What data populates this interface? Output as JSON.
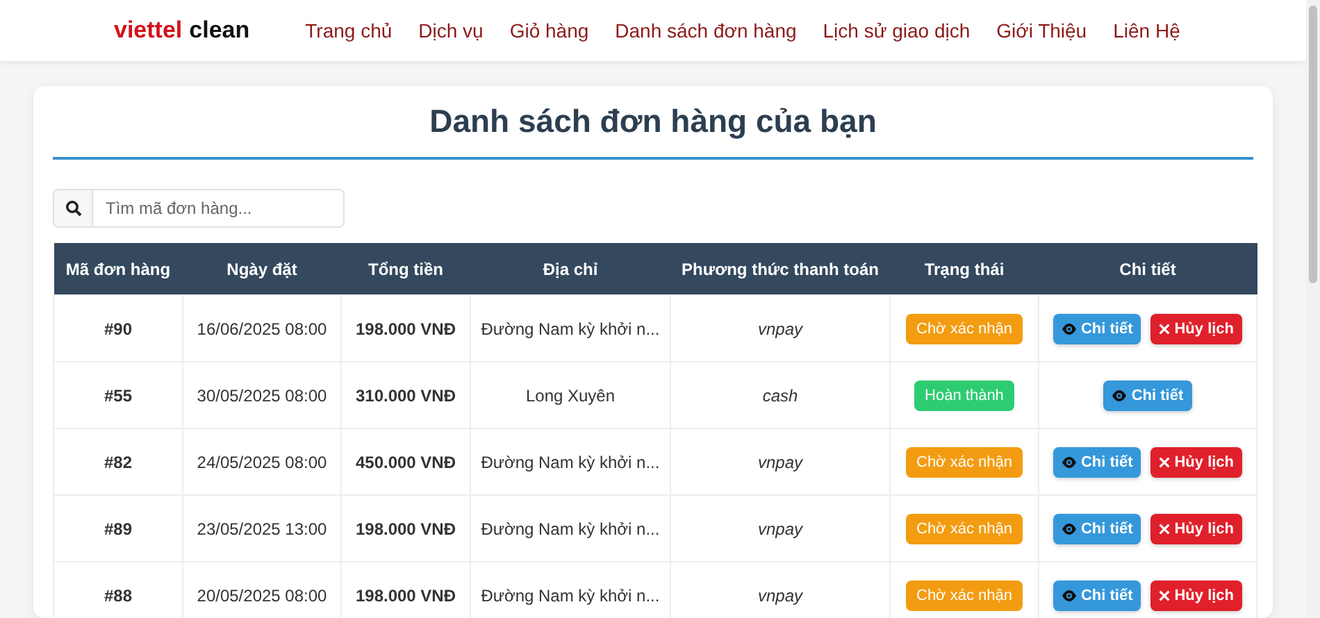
{
  "brand": {
    "first": "viettel",
    "second": "clean"
  },
  "nav": [
    {
      "label": "Trang chủ"
    },
    {
      "label": "Dịch vụ"
    },
    {
      "label": "Giỏ hàng"
    },
    {
      "label": "Danh sách đơn hàng"
    },
    {
      "label": "Lịch sử giao dịch"
    },
    {
      "label": "Giới Thiệu"
    },
    {
      "label": "Liên Hệ"
    }
  ],
  "title": "Danh sách đơn hàng của bạn",
  "search": {
    "placeholder": "Tìm mã đơn hàng..."
  },
  "table": {
    "columns": [
      "Mã đơn hàng",
      "Ngày đặt",
      "Tổng tiền",
      "Địa chỉ",
      "Phương thức thanh toán",
      "Trạng thái",
      "Chi tiết"
    ],
    "rows": [
      {
        "id": "#90",
        "date": "16/06/2025 08:00",
        "total": "198.000 VNĐ",
        "address": "Đường Nam kỳ khởi n...",
        "payment": "vnpay",
        "status": {
          "kind": "pending",
          "label": "Chờ xác nhận"
        },
        "actions": [
          {
            "kind": "detail",
            "label": "Chi tiết"
          },
          {
            "kind": "cancel",
            "label": "Hủy lịch"
          }
        ]
      },
      {
        "id": "#55",
        "date": "30/05/2025 08:00",
        "total": "310.000 VNĐ",
        "address": "Long Xuyên",
        "payment": "cash",
        "status": {
          "kind": "done",
          "label": "Hoàn thành"
        },
        "actions": [
          {
            "kind": "detail",
            "label": "Chi tiết"
          }
        ]
      },
      {
        "id": "#82",
        "date": "24/05/2025 08:00",
        "total": "450.000 VNĐ",
        "address": "Đường Nam kỳ khởi n...",
        "payment": "vnpay",
        "status": {
          "kind": "pending",
          "label": "Chờ xác nhận"
        },
        "actions": [
          {
            "kind": "detail",
            "label": "Chi tiết"
          },
          {
            "kind": "cancel",
            "label": "Hủy lịch"
          }
        ]
      },
      {
        "id": "#89",
        "date": "23/05/2025 13:00",
        "total": "198.000 VNĐ",
        "address": "Đường Nam kỳ khởi n...",
        "payment": "vnpay",
        "status": {
          "kind": "pending",
          "label": "Chờ xác nhận"
        },
        "actions": [
          {
            "kind": "detail",
            "label": "Chi tiết"
          },
          {
            "kind": "cancel",
            "label": "Hủy lịch"
          }
        ]
      },
      {
        "id": "#88",
        "date": "20/05/2025 08:00",
        "total": "198.000 VNĐ",
        "address": "Đường Nam kỳ khởi n...",
        "payment": "vnpay",
        "status": {
          "kind": "pending",
          "label": "Chờ xác nhận"
        },
        "actions": [
          {
            "kind": "detail",
            "label": "Chi tiết"
          },
          {
            "kind": "cancel",
            "label": "Hủy lịch"
          }
        ]
      }
    ]
  }
}
